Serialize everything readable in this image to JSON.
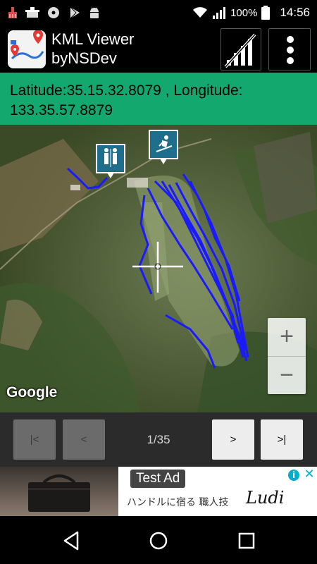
{
  "status_bar": {
    "battery_percent": "100%",
    "time": "14:56",
    "left_icons": [
      "cleaner-icon",
      "pot-icon",
      "disc-icon",
      "play-store-icon",
      "android-icon"
    ],
    "right_icons": [
      "wifi-icon",
      "cell-signal-icon",
      "battery-icon"
    ]
  },
  "app_bar": {
    "title_line1": "KML Viewer",
    "title_line2": "byNSDev",
    "actions": [
      "signal-toggle-icon",
      "overflow-menu-icon"
    ]
  },
  "location": {
    "text_line1": "Latitude:35.15.32.8079 , Longitude:",
    "text_line2": "133.35.57.8879"
  },
  "map": {
    "attribution": "Google",
    "zoom_in_label": "+",
    "zoom_out_label": "−",
    "markers": [
      "restroom-marker-icon",
      "skiing-marker-icon"
    ],
    "track_color": "#1a1aff",
    "crosshair": true
  },
  "navigation": {
    "first_label": "|<",
    "prev_label": "<",
    "page_indicator": "1/35",
    "next_label": ">",
    "last_label": ">|"
  },
  "ad": {
    "label": "Test Ad",
    "copy": "ハンドルに宿る 職人技",
    "brand": "Ludi"
  },
  "colors": {
    "accent": "#12a86e",
    "nav_disabled": "#6b6b6b",
    "nav_enabled": "#ededed"
  }
}
